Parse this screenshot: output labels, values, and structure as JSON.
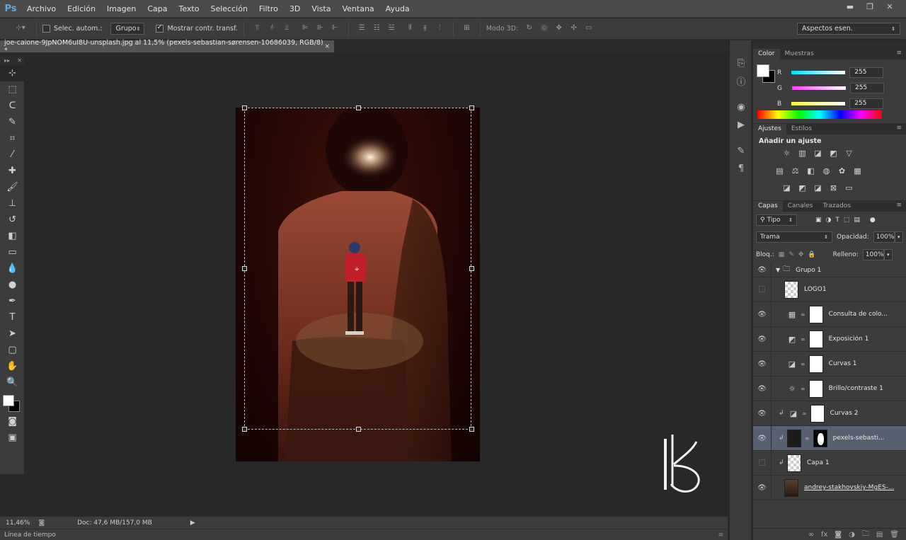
{
  "app": {
    "logo": "Ps"
  },
  "menu": [
    "Archivo",
    "Edición",
    "Imagen",
    "Capa",
    "Texto",
    "Selección",
    "Filtro",
    "3D",
    "Vista",
    "Ventana",
    "Ayuda"
  ],
  "window_controls": [
    "▬",
    "❐",
    "✕"
  ],
  "options": {
    "auto_select_label": "Selec. autom.:",
    "auto_select_value": "Grupo",
    "show_transform_label": "Mostrar contr. transf.",
    "mode3d_label": "Modo 3D:",
    "workspace": "Aspectos esen."
  },
  "document": {
    "tab_title": "joe-caione-9JpNOM6uI8U-unsplash.jpg al 11,5% (pexels-sebastian-sørensen-10686039, RGB/8) *",
    "close": "×"
  },
  "status": {
    "zoom": "11,46%",
    "doc": "Doc: 47,6 MB/157,0 MB",
    "timeline_label": "Línea de tiempo"
  },
  "color_panel": {
    "tabs": [
      "Color",
      "Muestras"
    ],
    "channels": [
      {
        "label": "R",
        "value": "255",
        "color": "#00e0ff"
      },
      {
        "label": "G",
        "value": "255",
        "color": "#ff40ff"
      },
      {
        "label": "B",
        "value": "255",
        "color": "#ffff40"
      }
    ]
  },
  "adjustments_panel": {
    "tabs": [
      "Ajustes",
      "Estilos"
    ],
    "title": "Añadir un ajuste"
  },
  "layers_panel": {
    "tabs": [
      "Capas",
      "Canales",
      "Trazados"
    ],
    "filter": "Tipo",
    "blend_mode": "Trama",
    "opacity_label": "Opacidad:",
    "opacity_value": "100%",
    "lock_label": "Bloq.:",
    "fill_label": "Relleno:",
    "fill_value": "100%",
    "layers": [
      {
        "name": "Grupo 1",
        "type": "group",
        "visible": true
      },
      {
        "name": "LOGO1",
        "type": "smart",
        "visible": false
      },
      {
        "name": "Consulta de colo...",
        "type": "adjustment",
        "icon": "▦",
        "visible": true
      },
      {
        "name": "Exposición 1",
        "type": "adjustment",
        "icon": "◩",
        "visible": true
      },
      {
        "name": "Curvas 1",
        "type": "adjustment",
        "icon": "◪",
        "visible": true
      },
      {
        "name": "Brillo/contraste 1",
        "type": "adjustment",
        "icon": "☼",
        "visible": true
      },
      {
        "name": "Curvas 2",
        "type": "adjustment",
        "icon": "◪",
        "visible": true,
        "clipped": true
      },
      {
        "name": "pexels-sebasti...",
        "type": "masked",
        "visible": true,
        "clipped": true,
        "selected": true
      },
      {
        "name": "Capa 1",
        "type": "pixel",
        "visible": false,
        "clipped": true
      },
      {
        "name": "andrey-stakhovskiy-MgES-...",
        "type": "photo",
        "visible": true
      }
    ]
  }
}
